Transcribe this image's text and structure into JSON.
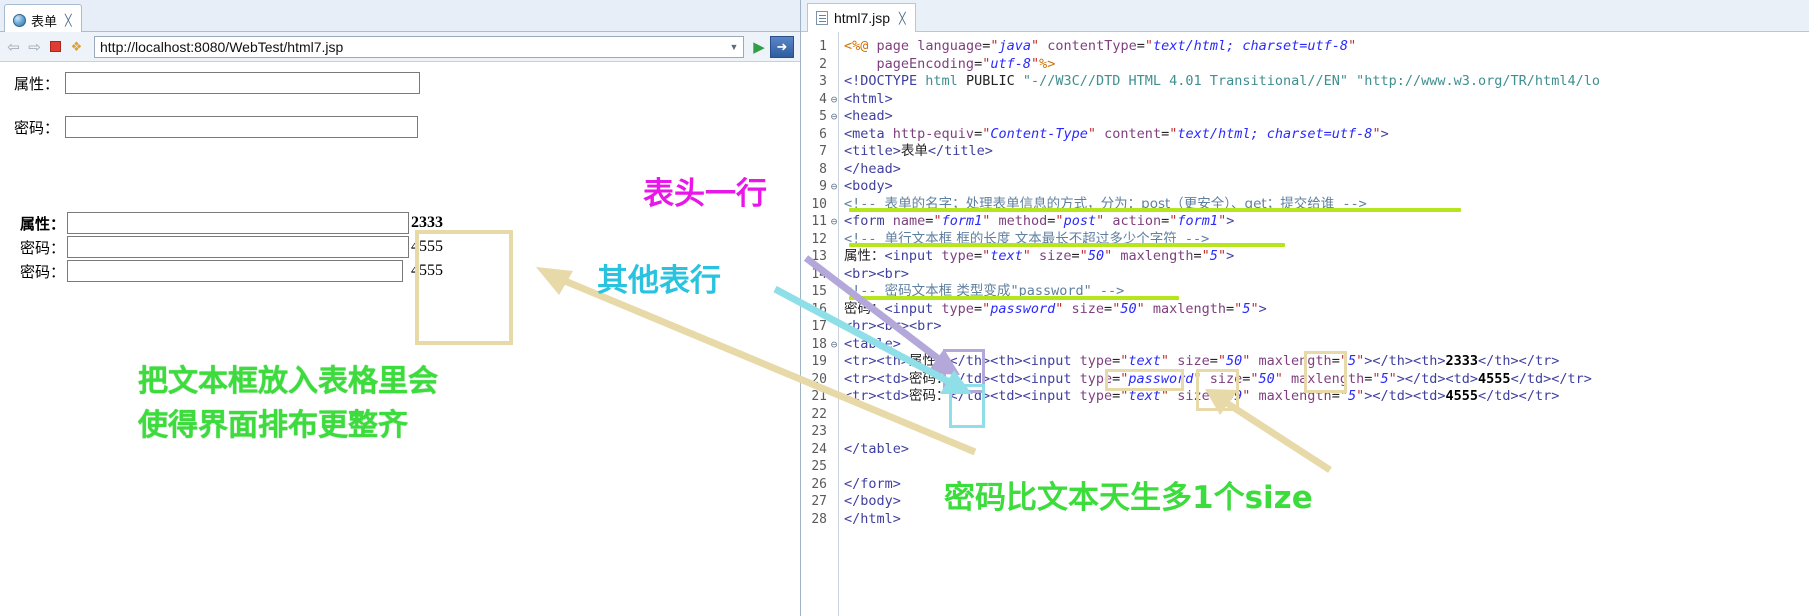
{
  "browser": {
    "tab": {
      "title": "表单",
      "icon": "globe-icon",
      "close": "✕"
    },
    "toolbar": {
      "back_icon": "⇦",
      "forward_icon": "⇨",
      "stop_icon": "stop-icon",
      "refresh_icon": "⚡",
      "url": "http://localhost:8080/WebTest/html7.jsp",
      "dropdown_icon": "▼",
      "go_icon": "▶",
      "open_external_icon": "➔"
    },
    "form": {
      "simple_rows": [
        {
          "label": "属性：",
          "value": "",
          "type": "text"
        },
        {
          "label": "密码：",
          "value": "",
          "type": "password"
        }
      ],
      "table_rows": [
        {
          "label": "属性：",
          "value": "",
          "number": "2333",
          "header": true
        },
        {
          "label": "密码：",
          "value": "",
          "number": "4555",
          "header": false
        },
        {
          "label": "密码：",
          "value": "",
          "number": "4555",
          "header": false
        }
      ]
    }
  },
  "editor": {
    "tab": {
      "title": "html7.jsp",
      "icon": "document-icon",
      "close": "✕"
    },
    "lines": [
      {
        "n": "1",
        "fold": "",
        "html": "<span class=\"dirm\">&lt;%@</span> <span class=\"dir\">page</span> <span class=\"attr\">language</span><span class=\"plain\">=</span><span class=\"valq\">\"</span><span class=\"val\">java</span><span class=\"valq\">\"</span> <span class=\"attr\">contentType</span><span class=\"plain\">=</span><span class=\"valq\">\"</span><span class=\"val\">text/html; charset=utf-8</span><span class=\"valq\">\"</span>"
      },
      {
        "n": "2",
        "fold": "",
        "html": "    <span class=\"attr\">pageEncoding</span><span class=\"plain\">=</span><span class=\"valq\">\"</span><span class=\"val\">utf-8</span><span class=\"valq\">\"</span><span class=\"dirm\">%&gt;</span>"
      },
      {
        "n": "3",
        "fold": "",
        "html": "<span class=\"tagp\">&lt;!DOCTYPE</span> <span class=\"doct\">html</span> <span class=\"plain\">PUBLIC</span> <span class=\"doct\">\"-//W3C//DTD HTML 4.01 Transitional//EN\"</span> <span class=\"doct\">\"http://www.w3.org/TR/html4/lo</span>"
      },
      {
        "n": "4",
        "fold": "⊖",
        "html": "<span class=\"tagp\">&lt;html&gt;</span>"
      },
      {
        "n": "5",
        "fold": "⊖",
        "html": "<span class=\"tagp\">&lt;head&gt;</span>"
      },
      {
        "n": "6",
        "fold": "",
        "html": "<span class=\"tagp\">&lt;meta</span> <span class=\"attr\">http-equiv</span><span class=\"plain\">=</span><span class=\"valq\">\"</span><span class=\"val\">Content-Type</span><span class=\"valq\">\"</span> <span class=\"attr\">content</span><span class=\"plain\">=</span><span class=\"valq\">\"</span><span class=\"val\">text/html; charset=utf-8</span><span class=\"valq\">\"</span><span class=\"tagp\">&gt;</span>"
      },
      {
        "n": "7",
        "fold": "",
        "html": "<span class=\"tagp\">&lt;title&gt;</span><span class=\"plain cjk\">表单</span><span class=\"tagp\">&lt;/title&gt;</span>"
      },
      {
        "n": "8",
        "fold": "",
        "html": "<span class=\"tagp\">&lt;/head&gt;</span>"
      },
      {
        "n": "9",
        "fold": "⊖",
        "html": "<span class=\"tagp\">&lt;body&gt;</span>"
      },
      {
        "n": "10",
        "fold": "",
        "html": "<span class=\"cmt\">&lt;!-- </span><span class=\"cmt cjk\">表单的名字；处理表单信息的方式，分为：post（更安全）、get；提交给谁</span><span class=\"cmt\"> --&gt;</span>"
      },
      {
        "n": "11",
        "fold": "⊖",
        "html": "<span class=\"tagp\">&lt;form</span> <span class=\"attr\">name</span><span class=\"plain\">=</span><span class=\"valq\">\"</span><span class=\"val\">form1</span><span class=\"valq\">\"</span> <span class=\"attr\">method</span><span class=\"plain\">=</span><span class=\"valq\">\"</span><span class=\"val\">post</span><span class=\"valq\">\"</span> <span class=\"attr\">action</span><span class=\"plain\">=</span><span class=\"valq\">\"</span><span class=\"val\">form1</span><span class=\"valq\">\"</span><span class=\"tagp\">&gt;</span>"
      },
      {
        "n": "12",
        "fold": "",
        "html": "<span class=\"cmt\">&lt;!-- </span><span class=\"cmt cjk\">单行文本框 框的长度 文本最长不超过多少个字符</span><span class=\"cmt\"> --&gt;</span>"
      },
      {
        "n": "13",
        "fold": "",
        "html": "<span class=\"plain cjk\">属性：</span><span class=\"tagp\">&lt;input</span> <span class=\"attr\">type</span><span class=\"plain\">=</span><span class=\"valq\">\"</span><span class=\"val\">text</span><span class=\"valq\">\"</span> <span class=\"attr\">size</span><span class=\"plain\">=</span><span class=\"valq\">\"</span><span class=\"val\">50</span><span class=\"valq\">\"</span> <span class=\"attr\">maxlength</span><span class=\"plain\">=</span><span class=\"valq\">\"</span><span class=\"val\">5</span><span class=\"valq\">\"</span><span class=\"tagp\">&gt;</span>"
      },
      {
        "n": "14",
        "fold": "",
        "html": "<span class=\"tagp\">&lt;br&gt;&lt;br&gt;</span>"
      },
      {
        "n": "15",
        "fold": "",
        "html": "<span class=\"cmt\">&lt;!-- </span><span class=\"cmt cjk\">密码文本框 类型变成</span><span class=\"cmt\">\"password\" --&gt;</span>"
      },
      {
        "n": "16",
        "fold": "",
        "html": "<span class=\"plain cjk\">密码：</span><span class=\"tagp\">&lt;input</span> <span class=\"attr\">type</span><span class=\"plain\">=</span><span class=\"valq\">\"</span><span class=\"val\">password</span><span class=\"valq\">\"</span> <span class=\"attr\">size</span><span class=\"plain\">=</span><span class=\"valq\">\"</span><span class=\"val\">50</span><span class=\"valq\">\"</span> <span class=\"attr\">maxlength</span><span class=\"plain\">=</span><span class=\"valq\">\"</span><span class=\"val\">5</span><span class=\"valq\">\"</span><span class=\"tagp\">&gt;</span>"
      },
      {
        "n": "17",
        "fold": "",
        "html": "<span class=\"tagp\">&lt;br&gt;&lt;br&gt;&lt;br&gt;</span>"
      },
      {
        "n": "18",
        "fold": "⊖",
        "html": "<span class=\"tagp\">&lt;table&gt;</span>"
      },
      {
        "n": "19",
        "fold": "",
        "html": "<span class=\"tagp\">&lt;tr&gt;&lt;th&gt;</span><span class=\"plain cjk\">属性：</span><span class=\"tagp\">&lt;/th&gt;&lt;th&gt;&lt;input</span> <span class=\"attr\">type</span><span class=\"plain\">=</span><span class=\"valq\">\"</span><span class=\"val\">text</span><span class=\"valq\">\"</span> <span class=\"attr\">size</span><span class=\"plain\">=</span><span class=\"valq\">\"</span><span class=\"val\">50</span><span class=\"valq\">\"</span> <span class=\"attr\">maxlength</span><span class=\"plain\">=</span><span class=\"valq\">\"</span><span class=\"val\">5</span><span class=\"valq\">\"</span><span class=\"tagp\">&gt;&lt;/th&gt;&lt;th&gt;</span><span class=\"num\">2333</span><span class=\"tagp\">&lt;/th&gt;&lt;/tr&gt;</span>"
      },
      {
        "n": "20",
        "fold": "",
        "html": "<span class=\"tagp\">&lt;tr&gt;&lt;td&gt;</span><span class=\"plain cjk\">密码：</span><span class=\"tagp\">&lt;/td&gt;&lt;td&gt;&lt;input</span> <span class=\"attr\">type</span><span class=\"plain\">=</span><span class=\"valq\">\"</span><span class=\"val\">password</span><span class=\"valq\">\"</span> <span class=\"attr\">size</span><span class=\"plain\">=</span><span class=\"valq\">\"</span><span class=\"val\">50</span><span class=\"valq\">\"</span> <span class=\"attr\">maxlength</span><span class=\"plain\">=</span><span class=\"valq\">\"</span><span class=\"val\">5</span><span class=\"valq\">\"</span><span class=\"tagp\">&gt;&lt;/td&gt;&lt;td&gt;</span><span class=\"num\">4555</span><span class=\"tagp\">&lt;/td&gt;&lt;/tr&gt;</span>"
      },
      {
        "n": "21",
        "fold": "",
        "html": "<span class=\"tagp\">&lt;tr&gt;&lt;td&gt;</span><span class=\"plain cjk\">密码：</span><span class=\"tagp\">&lt;/td&gt;&lt;td&gt;&lt;input</span> <span class=\"attr\">type</span><span class=\"plain\">=</span><span class=\"valq\">\"</span><span class=\"val\">text</span><span class=\"valq\">\"</span> <span class=\"attr\">size</span><span class=\"plain\">=</span><span class=\"valq\">\"</span><span class=\"val\">49</span><span class=\"valq\">\"</span> <span class=\"attr\">maxlength</span><span class=\"plain\">=</span><span class=\"valq\">\"</span><span class=\"val\">5</span><span class=\"valq\">\"</span><span class=\"tagp\">&gt;&lt;/td&gt;&lt;td&gt;</span><span class=\"num\">4555</span><span class=\"tagp\">&lt;/td&gt;&lt;/tr&gt;</span>"
      },
      {
        "n": "22",
        "fold": "",
        "html": ""
      },
      {
        "n": "23",
        "fold": "",
        "html": ""
      },
      {
        "n": "24",
        "fold": "",
        "html": "<span class=\"tagp\">&lt;/table&gt;</span>"
      },
      {
        "n": "25",
        "fold": "",
        "html": ""
      },
      {
        "n": "26",
        "fold": "",
        "html": "<span class=\"tagp\">&lt;/form&gt;</span>"
      },
      {
        "n": "27",
        "fold": "",
        "html": "<span class=\"tagp\">&lt;/body&gt;</span>"
      },
      {
        "n": "28",
        "fold": "",
        "html": "<span class=\"tagp\">&lt;/html&gt;</span>"
      }
    ]
  },
  "annotations": {
    "table_header_row": "表头一行",
    "other_table_rows": "其他表行",
    "textbox_in_table": "把文本框放入表格里会\n使得界面排布更整齐",
    "password_size": "密码比文本天生多1个size",
    "colors": {
      "magenta": "#e816e8",
      "cyan": "#29c3e0",
      "green": "#3ddc3d",
      "yellow_box": "#e8d9a8",
      "purple_box": "#b3a8d9",
      "marker_green": "#b5e61d"
    }
  }
}
